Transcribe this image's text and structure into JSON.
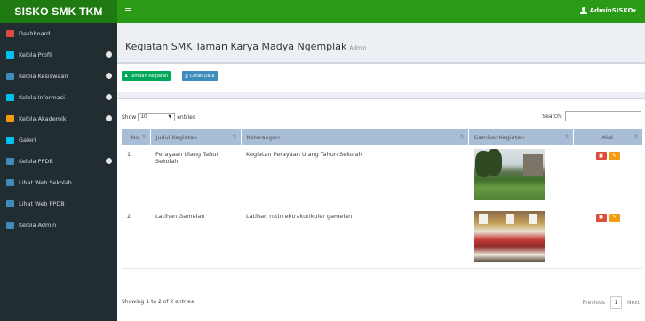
{
  "brand": "SISKO SMK TKM",
  "topbar": {
    "menu_glyph": "≡",
    "user_label": "AdminSISKO▾"
  },
  "sidebar": {
    "items": [
      {
        "label": "Dashboard",
        "icon": "dashboard-icon",
        "color": "#dd4b39",
        "has_arrow": false
      },
      {
        "label": "Kelola Profil",
        "icon": "gears-icon",
        "color": "#00c0ef",
        "has_arrow": true
      },
      {
        "label": "Kelola Kesiswaan",
        "icon": "graduation-cap-icon",
        "color": "#3c8dbc",
        "has_arrow": true
      },
      {
        "label": "Kelola Informasi",
        "icon": "bullhorn-icon",
        "color": "#00c0ef",
        "has_arrow": true
      },
      {
        "label": "Kelola Akademik",
        "icon": "institution-icon",
        "color": "#f39c12",
        "has_arrow": true
      },
      {
        "label": "Galeri",
        "icon": "image-icon",
        "color": "#00c0ef",
        "has_arrow": false
      },
      {
        "label": "Kelola PPDB",
        "icon": "users-icon",
        "color": "#3c8dbc",
        "has_arrow": true
      },
      {
        "label": "Lihat Web Sekolah",
        "icon": "desktop-icon",
        "color": "#3c8dbc",
        "has_arrow": false
      },
      {
        "label": "Lihat Web PPDB",
        "icon": "desktop-icon",
        "color": "#3c8dbc",
        "has_arrow": false
      },
      {
        "label": "Kelola Admin",
        "icon": "user-icon",
        "color": "#3c8dbc",
        "has_arrow": false
      }
    ]
  },
  "page": {
    "title": "Kegiatan SMK Taman Karya Madya Ngemplak",
    "subtitle": "Admin"
  },
  "toolbar": {
    "add_label": "Tambah Kegiatan",
    "print_label": "Cetak Data"
  },
  "table_controls": {
    "show_label": "Show",
    "show_value": "10",
    "entries_label": "entries",
    "search_label": "Search:"
  },
  "table": {
    "columns": [
      "No.",
      "Judul Kegiatan",
      "Keterangan",
      "Gambar Kegiatan",
      "Aksi"
    ],
    "rows": [
      {
        "no": "1",
        "judul": "Perayaan Ulang Tahun Sekolah",
        "keterangan": "Kegiatan Perayaan Ulang Tahun Sekolah"
      },
      {
        "no": "2",
        "judul": "Latihan Gamelan",
        "keterangan": "Latihan rutin ektrakurikuler gamelan"
      }
    ]
  },
  "footer": {
    "info": "Showing 1 to 2 of 2 entries",
    "previous": "Previous",
    "page": "1",
    "next": "Next"
  },
  "colors": {
    "brand": "#1f7a12",
    "topbar": "#2b9a16",
    "sidebar": "#222d32",
    "header_row": "#a8bdd6"
  }
}
